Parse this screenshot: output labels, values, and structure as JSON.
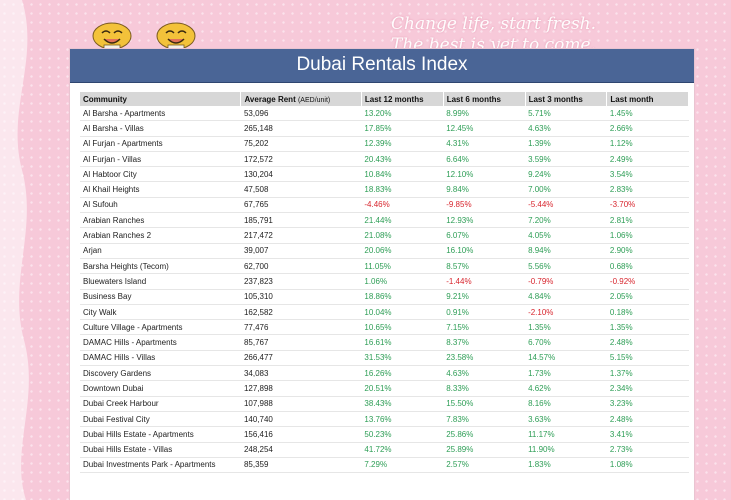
{
  "header": {
    "tagline_line1": "Change life, start fresh.",
    "tagline_line2": "The best is yet to come."
  },
  "page_title": "Dubai Rentals Index",
  "table": {
    "headers": {
      "community": "Community",
      "rent": "Average Rent",
      "rent_unit": "(AED/unit)",
      "m12": "Last 12 months",
      "m6": "Last 6 months",
      "m3": "Last 3 months",
      "m1": "Last month"
    },
    "rows": [
      {
        "community": "Al Barsha - Apartments",
        "rent": "53,096",
        "m12": "13.20%",
        "m6": "8.99%",
        "m3": "5.71%",
        "m1": "1.45%"
      },
      {
        "community": "Al Barsha - Villas",
        "rent": "265,148",
        "m12": "17.85%",
        "m6": "12.45%",
        "m3": "4.63%",
        "m1": "2.66%"
      },
      {
        "community": "Al Furjan - Apartments",
        "rent": "75,202",
        "m12": "12.39%",
        "m6": "4.31%",
        "m3": "1.39%",
        "m1": "1.12%"
      },
      {
        "community": "Al Furjan - Villas",
        "rent": "172,572",
        "m12": "20.43%",
        "m6": "6.64%",
        "m3": "3.59%",
        "m1": "2.49%"
      },
      {
        "community": "Al Habtoor City",
        "rent": "130,204",
        "m12": "10.84%",
        "m6": "12.10%",
        "m3": "9.24%",
        "m1": "3.54%"
      },
      {
        "community": "Al Khail Heights",
        "rent": "47,508",
        "m12": "18.83%",
        "m6": "9.84%",
        "m3": "7.00%",
        "m1": "2.83%"
      },
      {
        "community": "Al Sufouh",
        "rent": "67,765",
        "m12": "-4.46%",
        "m6": "-9.85%",
        "m3": "-5.44%",
        "m1": "-3.70%"
      },
      {
        "community": "Arabian Ranches",
        "rent": "185,791",
        "m12": "21.44%",
        "m6": "12.93%",
        "m3": "7.20%",
        "m1": "2.81%"
      },
      {
        "community": "Arabian Ranches 2",
        "rent": "217,472",
        "m12": "21.08%",
        "m6": "6.07%",
        "m3": "4.05%",
        "m1": "1.06%"
      },
      {
        "community": "Arjan",
        "rent": "39,007",
        "m12": "20.06%",
        "m6": "16.10%",
        "m3": "8.94%",
        "m1": "2.90%"
      },
      {
        "community": "Barsha Heights (Tecom)",
        "rent": "62,700",
        "m12": "11.05%",
        "m6": "8.57%",
        "m3": "5.56%",
        "m1": "0.68%"
      },
      {
        "community": "Bluewaters Island",
        "rent": "237,823",
        "m12": "1.06%",
        "m6": "-1.44%",
        "m3": "-0.79%",
        "m1": "-0.92%"
      },
      {
        "community": "Business Bay",
        "rent": "105,310",
        "m12": "18.86%",
        "m6": "9.21%",
        "m3": "4.84%",
        "m1": "2.05%"
      },
      {
        "community": "City Walk",
        "rent": "162,582",
        "m12": "10.04%",
        "m6": "0.91%",
        "m3": "-2.10%",
        "m1": "0.18%"
      },
      {
        "community": "Culture Village - Apartments",
        "rent": "77,476",
        "m12": "10.65%",
        "m6": "7.15%",
        "m3": "1.35%",
        "m1": "1.35%"
      },
      {
        "community": "DAMAC Hills - Apartments",
        "rent": "85,767",
        "m12": "16.61%",
        "m6": "8.37%",
        "m3": "6.70%",
        "m1": "2.48%"
      },
      {
        "community": "DAMAC Hills - Villas",
        "rent": "266,477",
        "m12": "31.53%",
        "m6": "23.58%",
        "m3": "14.57%",
        "m1": "5.15%"
      },
      {
        "community": "Discovery Gardens",
        "rent": "34,083",
        "m12": "16.26%",
        "m6": "4.63%",
        "m3": "1.73%",
        "m1": "1.37%"
      },
      {
        "community": "Downtown Dubai",
        "rent": "127,898",
        "m12": "20.51%",
        "m6": "8.33%",
        "m3": "4.62%",
        "m1": "2.34%"
      },
      {
        "community": "Dubai Creek Harbour",
        "rent": "107,988",
        "m12": "38.43%",
        "m6": "15.50%",
        "m3": "8.16%",
        "m1": "3.23%"
      },
      {
        "community": "Dubai Festival City",
        "rent": "140,740",
        "m12": "13.76%",
        "m6": "7.83%",
        "m3": "3.63%",
        "m1": "2.48%"
      },
      {
        "community": "Dubai Hills Estate - Apartments",
        "rent": "156,416",
        "m12": "50.23%",
        "m6": "25.86%",
        "m3": "11.17%",
        "m1": "3.41%"
      },
      {
        "community": "Dubai Hills Estate - Villas",
        "rent": "248,254",
        "m12": "41.72%",
        "m6": "25.89%",
        "m3": "11.90%",
        "m1": "2.73%"
      },
      {
        "community": "Dubai Investments Park - Apartments",
        "rent": "85,359",
        "m12": "7.29%",
        "m6": "2.57%",
        "m3": "1.83%",
        "m1": "1.08%"
      }
    ]
  },
  "colors": {
    "positive": "#2e9e56",
    "negative": "#d8262e",
    "title_bar": "#4a6596",
    "background": "#f7c9d9"
  },
  "icons": {
    "mascots": "smiling-cartoon-characters-icon"
  }
}
